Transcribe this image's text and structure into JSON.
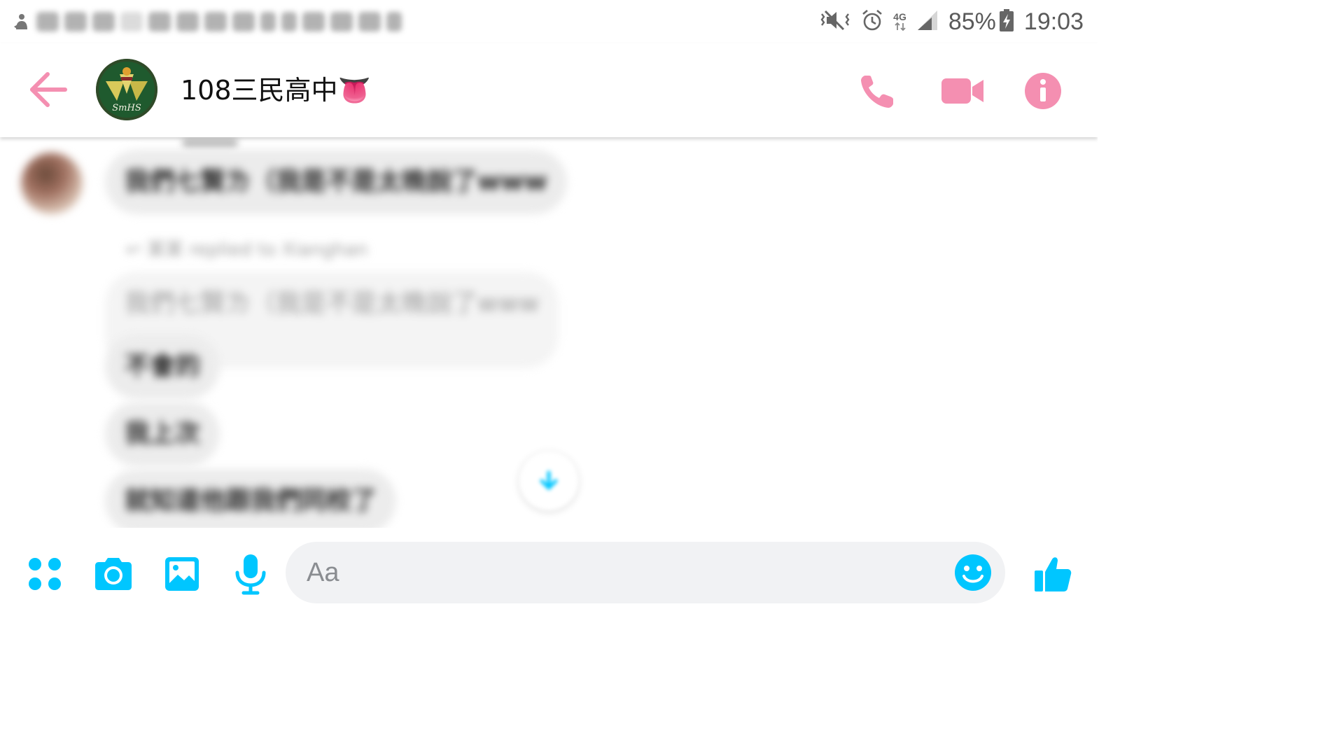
{
  "status_bar": {
    "battery": "85%",
    "time": "19:03",
    "network": "4G"
  },
  "header": {
    "title": "108三民高中👅",
    "avatar_text": "SmHS"
  },
  "messages": {
    "message_1": "我們七賢ㄌ（我是不是太晚說了www",
    "reply_note": "某某 replied to Xianghan",
    "quoted_reply": "我們七賢ㄌ（我是不是太晚說了www",
    "message_2": "不會的",
    "message_3": "我上次",
    "message_4": "就知道他跟我們同校了"
  },
  "composer": {
    "placeholder": "Aa"
  },
  "colors": {
    "header_accent": "#f48fb1",
    "composer_accent": "#00c6ff",
    "bubble_received": "#ececec"
  },
  "icons": {
    "back": "arrow-left-icon",
    "call": "phone-icon",
    "video": "video-camera-icon",
    "info": "info-icon",
    "apps": "grid-dots-icon",
    "camera": "camera-icon",
    "gallery": "image-icon",
    "voice": "microphone-icon",
    "emoji": "smiley-icon",
    "like": "thumbs-up-icon"
  }
}
